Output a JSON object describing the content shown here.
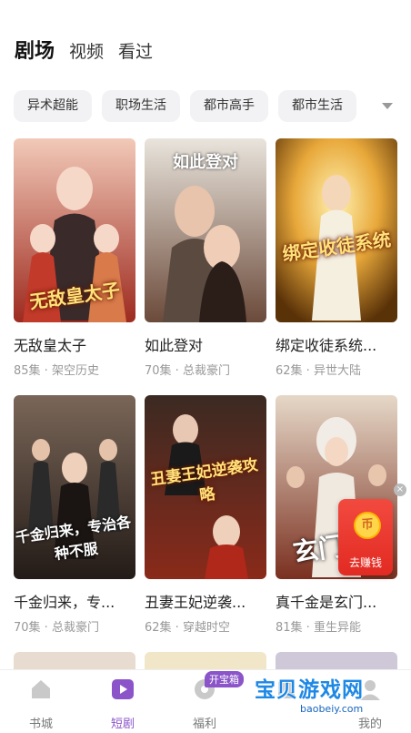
{
  "header": {
    "tabs": [
      {
        "label": "剧场"
      },
      {
        "label": "视频"
      },
      {
        "label": "看过"
      }
    ]
  },
  "categories": {
    "chips": [
      "异术超能",
      "职场生活",
      "都市高手",
      "都市生活"
    ],
    "more_icon": "chevron-down-icon"
  },
  "dramas": [
    {
      "title": "无敌皇太子",
      "episodes": "85集",
      "genre": "架空历史",
      "poster_caption": "无敌皇太子",
      "colors": [
        "#f2c9b8",
        "#9d2a1f"
      ]
    },
    {
      "title": "如此登对",
      "episodes": "70集",
      "genre": "总裁豪门",
      "poster_caption": "如此登对",
      "colors": [
        "#e3ddd3",
        "#6b4a3a"
      ]
    },
    {
      "title": "绑定收徒系统...",
      "episodes": "62集",
      "genre": "异世大陆",
      "poster_caption": "绑定收徒系统",
      "colors": [
        "#f6d36b",
        "#8a5a14"
      ]
    },
    {
      "title": "千金归来，专...",
      "episodes": "70集",
      "genre": "总裁豪门",
      "poster_caption": "千金归来，专治各种不服",
      "colors": [
        "#6e5a4e",
        "#2a211c"
      ]
    },
    {
      "title": "丑妻王妃逆袭...",
      "episodes": "62集",
      "genre": "穿越时空",
      "poster_caption": "丑妻王妃逆袭攻略",
      "colors": [
        "#3b2a22",
        "#8a2a1a"
      ]
    },
    {
      "title": "真千金是玄门...",
      "episodes": "81集",
      "genre": "重生异能",
      "poster_caption": "玄门",
      "colors": [
        "#d8c6b4",
        "#7a3020"
      ]
    }
  ],
  "reward": {
    "label": "去赚钱",
    "coin_glyph": "币"
  },
  "bottom_nav": {
    "items": [
      {
        "label": "书城",
        "icon": "home-icon"
      },
      {
        "label": "短剧",
        "icon": "play-icon"
      },
      {
        "label": "福利",
        "icon": "gift-icon"
      },
      {
        "label": "",
        "icon": "shelf-icon"
      },
      {
        "label": "我的",
        "icon": "profile-icon"
      }
    ],
    "box_badge": "开宝箱"
  },
  "watermark": {
    "text": "宝贝游戏网",
    "sub": "baobeiy.com"
  }
}
